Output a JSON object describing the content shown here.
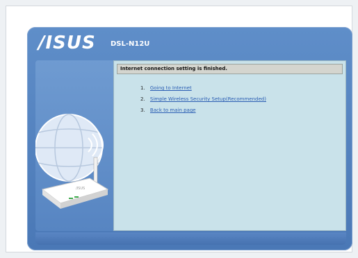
{
  "brand": {
    "logo_text": "/ISUS",
    "model": "DSL-N12U"
  },
  "status": {
    "message": "Internet connection setting is finished."
  },
  "options": [
    {
      "number": "1.",
      "label": "Going to Internet"
    },
    {
      "number": "2.",
      "label": "Simple Wireless Security Setup(Recommended)"
    },
    {
      "number": "3.",
      "label": "Back to main page"
    }
  ],
  "colors": {
    "frame_blue": "#4a78b6",
    "content_bg": "#c9e2ea",
    "link": "#2a5db3"
  }
}
